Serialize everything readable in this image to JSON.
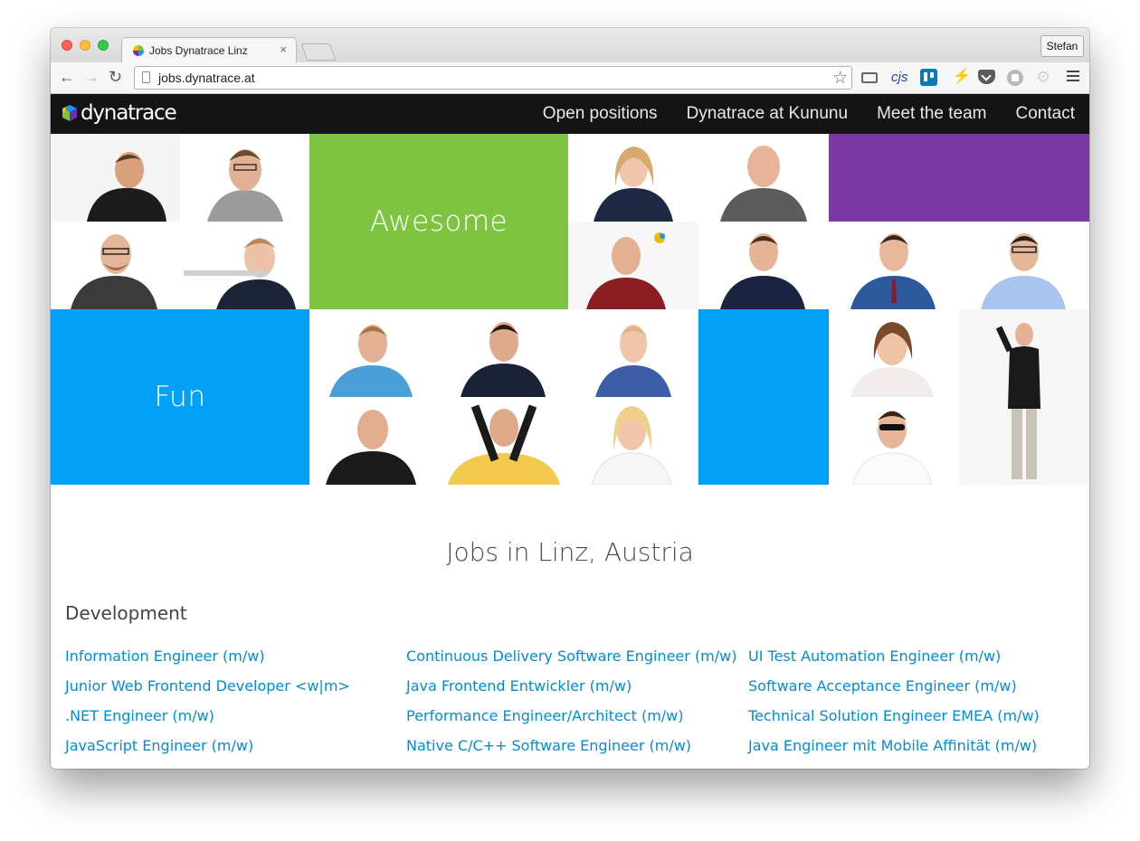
{
  "browser": {
    "tab_title": "Jobs Dynatrace Linz",
    "tab_close": "×",
    "profile_name": "Stefan",
    "url": "jobs.dynatrace.at",
    "back": "←",
    "forward": "→",
    "reload": "↻",
    "bookmark_star": "☆",
    "extensions": [
      "cast-icon",
      "cjs-icon",
      "trello-icon",
      "lightning-icon",
      "pocket-icon",
      "ad-block-icon",
      "gear-icon",
      "menu-icon"
    ],
    "cjs_label": "cjs",
    "lightning": "⚡",
    "gear": "⚙"
  },
  "site": {
    "logo_text": "dynatrace",
    "nav": [
      "Open positions",
      "Dynatrace at Kununu",
      "Meet the team",
      "Contact"
    ]
  },
  "mosaic": {
    "tiles": [
      {
        "label": "Awesome",
        "color": "#7dc540"
      },
      {
        "label": "",
        "color": "#7b37a6"
      },
      {
        "label": "Fun",
        "color": "#00a1f7"
      },
      {
        "label": "",
        "color": "#00a1f7"
      }
    ]
  },
  "content": {
    "heading": "Jobs in Linz, Austria",
    "category": "Development",
    "jobs": [
      [
        "Information Engineer (m/w)",
        "Continuous Delivery Software Engineer (m/w)",
        "UI Test Automation Engineer (m/w)"
      ],
      [
        "Junior Web Frontend Developer <w|m>",
        "Java Frontend Entwickler (m/w)",
        "Software Acceptance Engineer (m/w)"
      ],
      [
        ".NET Engineer (m/w)",
        "Performance Engineer/Architect (m/w)",
        "Technical Solution Engineer EMEA (m/w)"
      ],
      [
        "JavaScript Engineer (m/w)",
        "Native C/C++ Software Engineer (m/w)",
        "Java Engineer mit Mobile Affinität (m/w)"
      ]
    ]
  }
}
